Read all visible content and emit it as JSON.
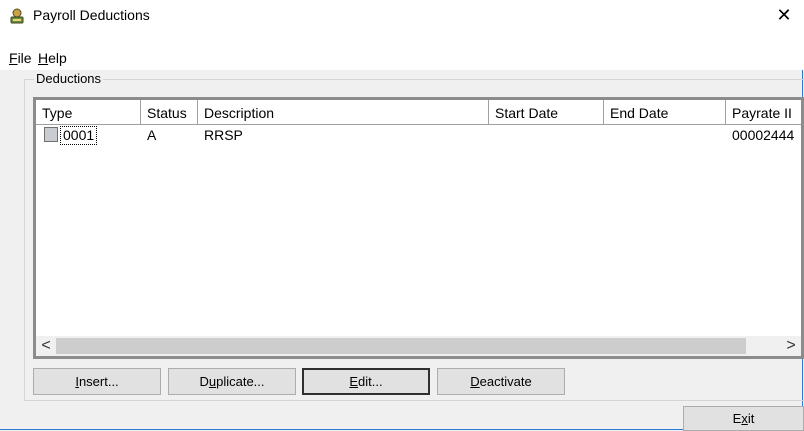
{
  "window": {
    "title": "Payroll Deductions",
    "close_glyph": "✕"
  },
  "menu": [
    {
      "label": "File",
      "accel": "F",
      "rest": "ile"
    },
    {
      "label": "Help",
      "accel": "H",
      "rest": "elp"
    }
  ],
  "group": {
    "label": "Deductions"
  },
  "grid": {
    "columns": [
      "Type",
      "Status",
      "Description",
      "Start Date",
      "End Date",
      "Payrate II"
    ],
    "rows": [
      {
        "type": "0001",
        "status": "A",
        "description": "RRSP",
        "start": "",
        "end": "",
        "payrate": "00002444"
      }
    ],
    "scroll_left": "<",
    "scroll_right": ">"
  },
  "buttons": {
    "insert": {
      "accel": "I",
      "rest": "nsert..."
    },
    "duplicate": {
      "pre": "D",
      "accel": "u",
      "rest": "plicate..."
    },
    "edit": {
      "accel": "E",
      "rest": "dit..."
    },
    "deactivate": {
      "accel": "D",
      "rest": "eactivate"
    },
    "exit": {
      "pre": "E",
      "accel": "x",
      "rest": "it"
    }
  }
}
